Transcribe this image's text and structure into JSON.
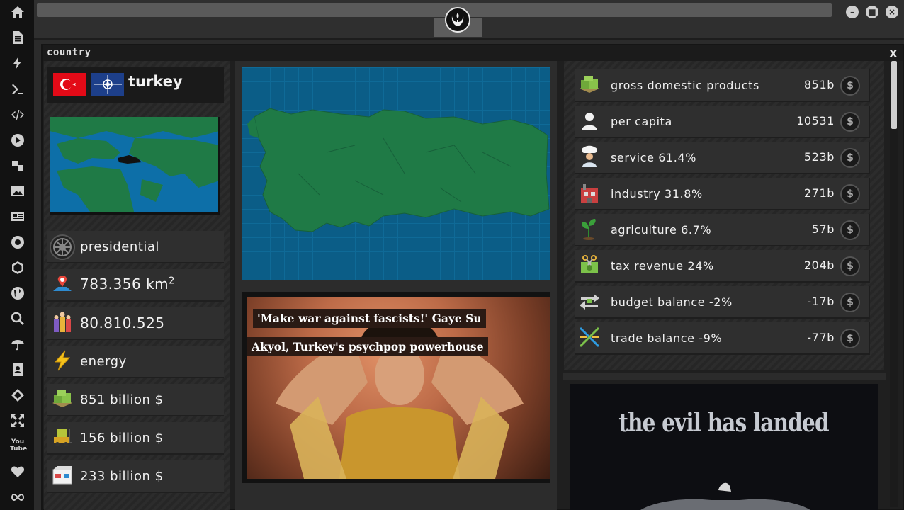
{
  "panel": {
    "title": "country",
    "close": "x"
  },
  "country": {
    "name": "turkey"
  },
  "stats": [
    {
      "icon": "imperial-emblem-icon",
      "label": "presidential",
      "sup": ""
    },
    {
      "icon": "map-pin-icon",
      "label": "783.356 km",
      "sup": "2"
    },
    {
      "icon": "population-icon",
      "label": "80.810.525",
      "sup": ""
    },
    {
      "icon": "lightning-icon",
      "label": "energy",
      "sup": ""
    },
    {
      "icon": "money-stack-icon",
      "label": "851 billion $",
      "sup": ""
    },
    {
      "icon": "forklift-icon",
      "label": "156 billion $",
      "sup": ""
    },
    {
      "icon": "boxes-icon",
      "label": "233 billion $",
      "sup": ""
    }
  ],
  "economy": [
    {
      "icon": "money-stack-icon",
      "label": "gross domestic products",
      "value": "851b"
    },
    {
      "icon": "person-icon",
      "label": "per capita",
      "value": "10531"
    },
    {
      "icon": "chef-icon",
      "label": "service 61.4%",
      "value": "523b"
    },
    {
      "icon": "factory-icon",
      "label": "industry 31.8%",
      "value": "271b"
    },
    {
      "icon": "plant-icon",
      "label": "agriculture 6.7%",
      "value": "57b"
    },
    {
      "icon": "money-scissors-icon",
      "label": "tax revenue 24%",
      "value": "204b"
    },
    {
      "icon": "arrows-exchange-icon",
      "label": "budget balance -2%",
      "value": "-17b"
    },
    {
      "icon": "trade-cross-icon",
      "label": "trade balance -9%",
      "value": "-77b"
    }
  ],
  "news": {
    "line1": "'Make war against fascists!' Gaye Su",
    "line2": "Akyol, Turkey's psychpop powerhouse"
  },
  "poster": {
    "text": "the evil has landed"
  },
  "colors": {
    "map_land": "#1f7a46",
    "map_water": "#0b5d87",
    "flag_tr": "#e30a17",
    "flag_nato": "#1d3f8a"
  }
}
